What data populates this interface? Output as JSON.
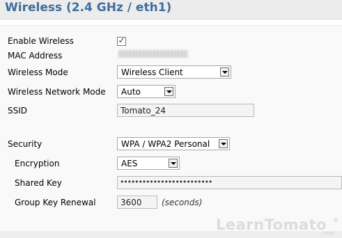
{
  "header": {
    "title": "Wireless (2.4 GHz / eth1)"
  },
  "form": {
    "enable_wireless": {
      "label": "Enable Wireless",
      "checked": true
    },
    "mac_address": {
      "label": "MAC Address"
    },
    "wireless_mode": {
      "label": "Wireless Mode",
      "value": "Wireless Client"
    },
    "network_mode": {
      "label": "Wireless Network Mode",
      "value": "Auto"
    },
    "ssid": {
      "label": "SSID",
      "value": "Tomato_24"
    },
    "security": {
      "label": "Security",
      "value": "WPA / WPA2 Personal"
    },
    "encryption": {
      "label": "Encryption",
      "value": "AES"
    },
    "shared_key": {
      "label": "Shared Key",
      "value": "•••••••••••••••••••••••••"
    },
    "group_key_renewal": {
      "label": "Group Key Renewal",
      "value": "3600",
      "unit_note": "(seconds)"
    }
  },
  "watermark": {
    "text": "LearnTomato",
    "sub": ".com",
    "reg": "®"
  },
  "colors": {
    "title": "#3f6f9c",
    "header_bg": "#ececec",
    "panel_bg": "#f9f9f9"
  }
}
